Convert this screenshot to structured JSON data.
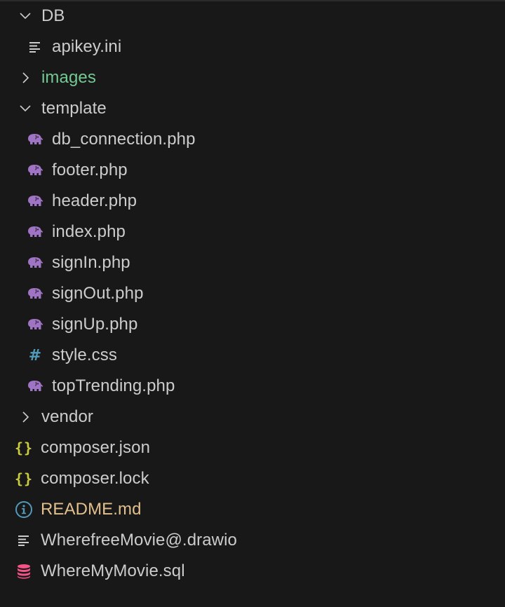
{
  "colors": {
    "background": "#181818",
    "text": "#cccccc",
    "php_icon": "#a074c4",
    "css_icon": "#519aba",
    "json_icon": "#cbcb41",
    "info_icon": "#519aba",
    "sql_icon": "#f55385",
    "untracked_text": "#73c991",
    "modified_text": "#e2c08d"
  },
  "explorer": {
    "items": [
      {
        "label": "DB",
        "type": "folder",
        "expanded": true,
        "icon": "chevron-down-icon"
      },
      {
        "label": "apikey.ini",
        "type": "file",
        "icon": "lines-icon"
      },
      {
        "label": "images",
        "type": "folder",
        "expanded": false,
        "icon": "chevron-right-icon"
      },
      {
        "label": "template",
        "type": "folder",
        "expanded": true,
        "icon": "chevron-down-icon"
      },
      {
        "label": "db_connection.php",
        "type": "file",
        "icon": "php-elephant-icon"
      },
      {
        "label": "footer.php",
        "type": "file",
        "icon": "php-elephant-icon"
      },
      {
        "label": "header.php",
        "type": "file",
        "icon": "php-elephant-icon"
      },
      {
        "label": "index.php",
        "type": "file",
        "icon": "php-elephant-icon"
      },
      {
        "label": "signIn.php",
        "type": "file",
        "icon": "php-elephant-icon"
      },
      {
        "label": "signOut.php",
        "type": "file",
        "icon": "php-elephant-icon"
      },
      {
        "label": "signUp.php",
        "type": "file",
        "icon": "php-elephant-icon"
      },
      {
        "label": "style.css",
        "type": "file",
        "icon": "hash-icon"
      },
      {
        "label": "topTrending.php",
        "type": "file",
        "icon": "php-elephant-icon"
      },
      {
        "label": "vendor",
        "type": "folder",
        "expanded": false,
        "icon": "chevron-right-icon"
      },
      {
        "label": "composer.json",
        "type": "file",
        "icon": "braces-icon"
      },
      {
        "label": "composer.lock",
        "type": "file",
        "icon": "braces-icon"
      },
      {
        "label": "README.md",
        "type": "file",
        "icon": "info-icon"
      },
      {
        "label": "WherefreeMovie@.drawio",
        "type": "file",
        "icon": "lines-icon"
      },
      {
        "label": "WhereMyMovie.sql",
        "type": "file",
        "icon": "database-icon"
      }
    ]
  }
}
